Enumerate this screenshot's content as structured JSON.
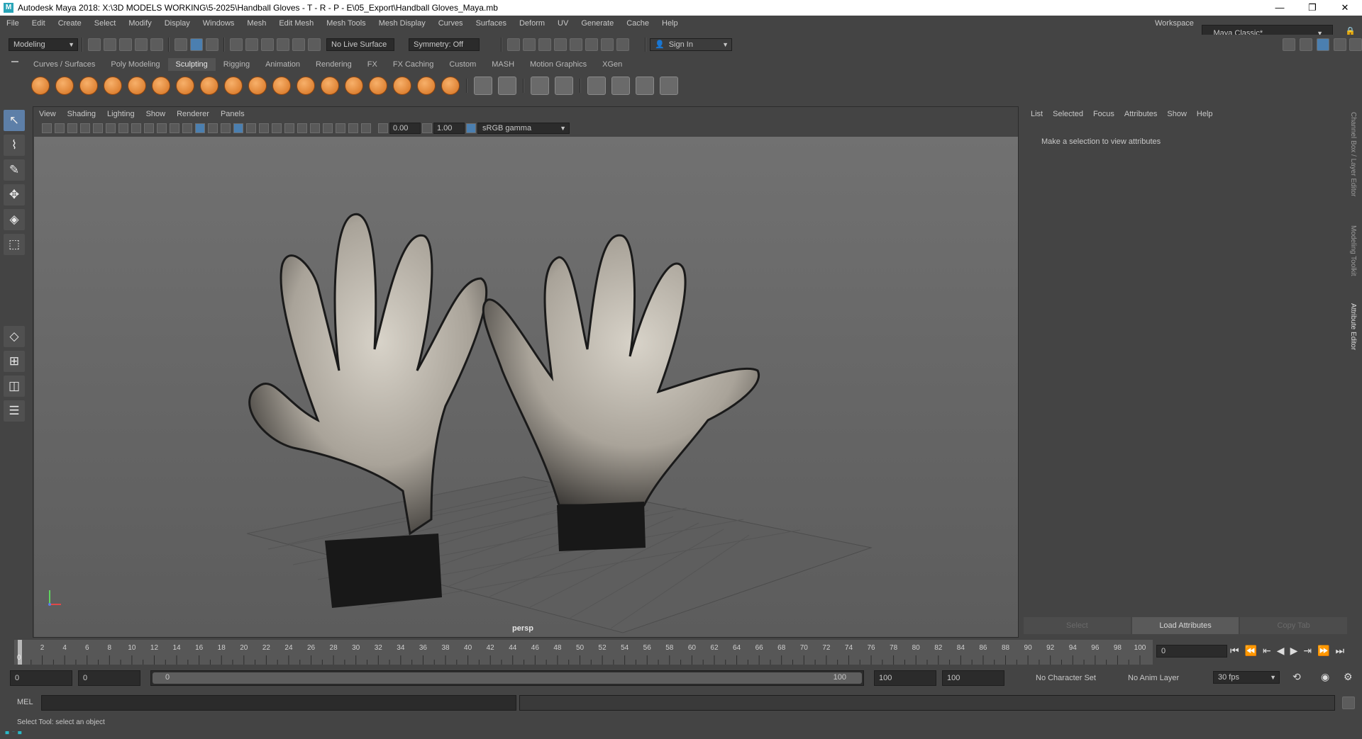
{
  "window": {
    "title": "Autodesk Maya 2018: X:\\3D MODELS WORKING\\5-2025\\Handball Gloves - T - R - P - E\\05_Export\\Handball Gloves_Maya.mb",
    "minimize": "—",
    "restore": "❐",
    "close": "✕"
  },
  "menubar": {
    "items": [
      "File",
      "Edit",
      "Create",
      "Select",
      "Modify",
      "Display",
      "Windows",
      "Mesh",
      "Edit Mesh",
      "Mesh Tools",
      "Mesh Display",
      "Curves",
      "Surfaces",
      "Deform",
      "UV",
      "Generate",
      "Cache",
      "Help"
    ],
    "workspace_label": "Workspace :",
    "workspace_value": "Maya Classic*"
  },
  "statusline": {
    "mode": "Modeling",
    "live_surface": "No Live Surface",
    "symmetry": "Symmetry: Off",
    "sign_in": "Sign In"
  },
  "shelf": {
    "tabs": [
      "Curves / Surfaces",
      "Poly Modeling",
      "Sculpting",
      "Rigging",
      "Animation",
      "Rendering",
      "FX",
      "FX Caching",
      "Custom",
      "MASH",
      "Motion Graphics",
      "XGen"
    ],
    "active_tab": "Sculpting"
  },
  "viewport": {
    "menu": [
      "View",
      "Shading",
      "Lighting",
      "Show",
      "Renderer",
      "Panels"
    ],
    "exposure": "0.00",
    "gamma": "1.00",
    "color_space": "sRGB gamma",
    "camera_label": "persp"
  },
  "attribute_editor": {
    "menu": [
      "List",
      "Selected",
      "Focus",
      "Attributes",
      "Show",
      "Help"
    ],
    "message": "Make a selection to view attributes",
    "buttons": [
      "Select",
      "Load Attributes",
      "Copy Tab"
    ],
    "side_tabs": [
      "Channel Box / Layer Editor",
      "Modeling Toolkit",
      "Attribute Editor"
    ]
  },
  "timeline": {
    "ticks": [
      2,
      4,
      6,
      8,
      10,
      12,
      14,
      16,
      18,
      20,
      22,
      24,
      26,
      28,
      30,
      32,
      34,
      36,
      38,
      40,
      42,
      44,
      46,
      48,
      50,
      52,
      54,
      56,
      58,
      60,
      62,
      64,
      66,
      68,
      70,
      72,
      74,
      76,
      78,
      80,
      82,
      84,
      86,
      88,
      90,
      92,
      94,
      96,
      98,
      100
    ],
    "start": 0,
    "end": 100,
    "current_frame_label": "0",
    "current_frame_field": "0"
  },
  "range": {
    "start": "0",
    "inner_start": "0",
    "slider_start": "0",
    "slider_end": "100",
    "inner_end": "100",
    "end": "100",
    "character_set": "No Character Set",
    "anim_layer": "No Anim Layer",
    "fps": "30 fps"
  },
  "command": {
    "language": "MEL"
  },
  "help_line": "Select Tool: select an object",
  "colors": {
    "accent": "#5d7fa8",
    "maya_logo": "#2ab8c8"
  }
}
